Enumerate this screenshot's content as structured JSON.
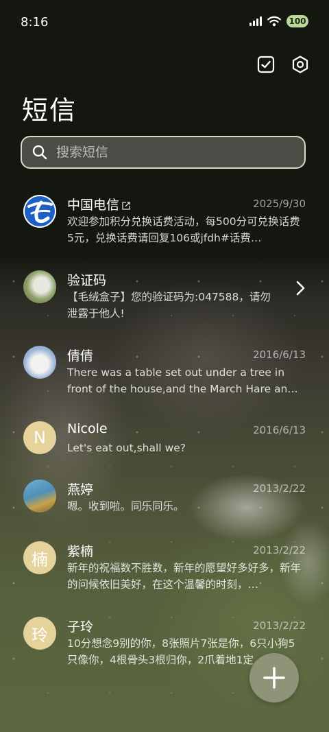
{
  "status_bar": {
    "time": "8:16",
    "battery": "100"
  },
  "header": {
    "title": "短信"
  },
  "search": {
    "placeholder": "搜索短信"
  },
  "conversations": [
    {
      "name": "中国电信",
      "date": "2025/9/30",
      "preview": "欢迎参加积分兑换话费活动，每500分可兑换话费5元，兑换话费请回复106或jfdh#话费…",
      "avatar": "china-telecom-logo"
    },
    {
      "name": "验证码",
      "date": "",
      "preview": "【毛绒盒子】您的验证码为:047588，请勿泄露于他人!",
      "avatar": "animal-photo"
    },
    {
      "name": "倩倩",
      "date": "2016/6/13",
      "preview": "There was a table set out under a tree in front of the house,and the March Hare an…",
      "avatar": "polar-bear-photo"
    },
    {
      "name": "Nicole",
      "date": "2016/6/13",
      "preview": "Let's eat out,shall we?",
      "avatar_letter": "N"
    },
    {
      "name": "燕婷",
      "date": "2013/2/22",
      "preview": "嗯。收到啦。同乐同乐。",
      "avatar": "landscape-photo"
    },
    {
      "name": "紫楠",
      "date": "2013/2/22",
      "preview": "新年的祝福数不胜数，新年的愿望好多好多，新年的问候依旧美好，在这个温馨的时刻，…",
      "avatar_letter": "楠"
    },
    {
      "name": "子玲",
      "date": "2013/2/22",
      "preview": "10分想念9别的你，8张照片7张是你，6只小狗5只像你，4根骨头3根归你，2爪着地1定…",
      "avatar_letter": "玲"
    }
  ],
  "colors": {
    "avatar_letter_bg": "#e6d29b",
    "fab_bg": "#8f9378",
    "search_border": "#d8d9c6"
  }
}
